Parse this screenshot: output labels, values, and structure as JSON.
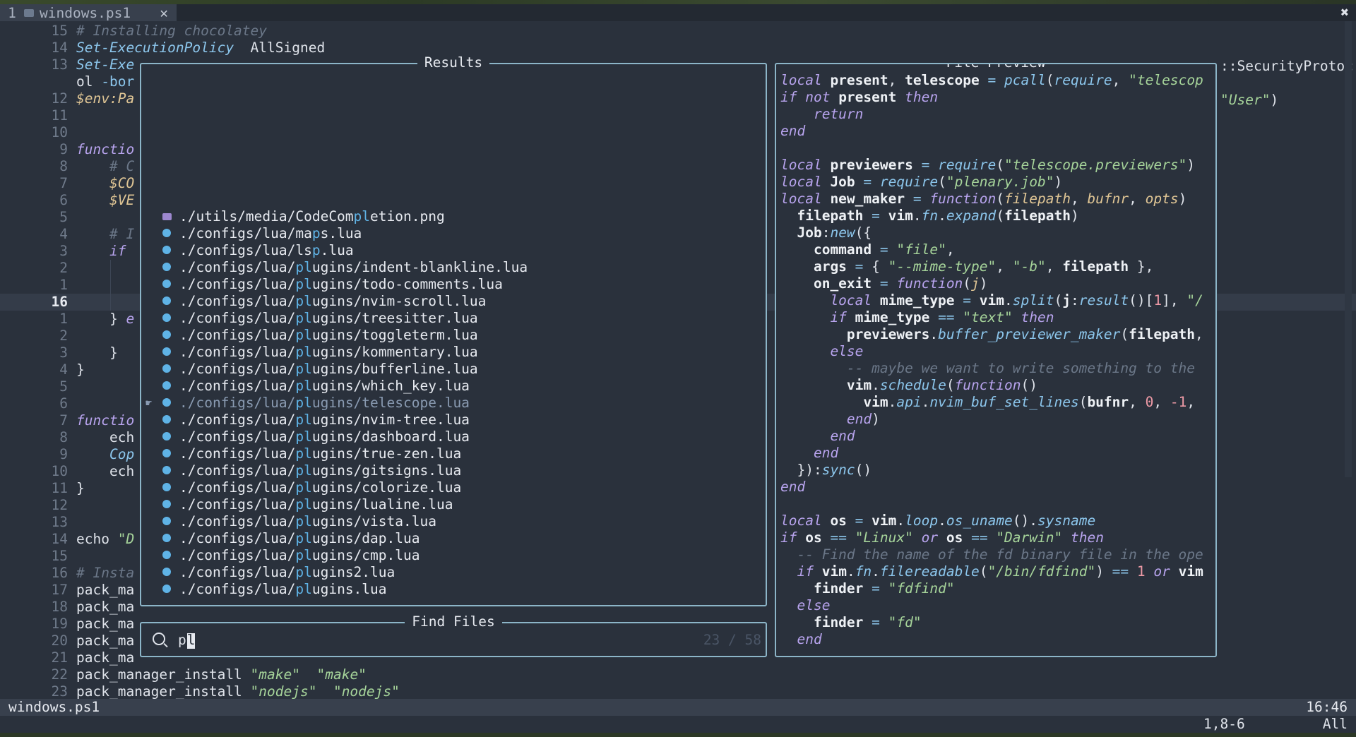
{
  "tabline": {
    "number": "1",
    "filename": "windows.ps1",
    "close": "✕",
    "window_close": "✖"
  },
  "editor": {
    "lines": [
      {
        "n": "15",
        "parts": [
          [
            "cm",
            "# Installing chocolatey"
          ]
        ]
      },
      {
        "n": "14",
        "parts": [
          [
            "fn",
            "Set-ExecutionPolicy"
          ],
          [
            "",
            "  AllSigned"
          ]
        ]
      },
      {
        "n": "13",
        "parts": [
          [
            "fn",
            "Set-Exe"
          ]
        ]
      },
      {
        "n": "",
        "parts": [
          [
            "",
            "ol "
          ],
          [
            "op",
            "-bor"
          ]
        ]
      },
      {
        "n": "12",
        "parts": [
          [
            "var",
            "$env:Pa"
          ]
        ]
      },
      {
        "n": "11",
        "parts": []
      },
      {
        "n": "10",
        "parts": []
      },
      {
        "n": "9",
        "parts": [
          [
            "kw",
            "functio"
          ]
        ]
      },
      {
        "n": "8",
        "parts": [
          [
            "",
            "    "
          ],
          [
            "cm",
            "# C"
          ]
        ]
      },
      {
        "n": "7",
        "parts": [
          [
            "",
            "    "
          ],
          [
            "var",
            "$CO"
          ]
        ]
      },
      {
        "n": "6",
        "parts": [
          [
            "",
            "    "
          ],
          [
            "var",
            "$VE"
          ]
        ]
      },
      {
        "n": "5",
        "parts": []
      },
      {
        "n": "4",
        "parts": [
          [
            "",
            "    "
          ],
          [
            "cm",
            "# I"
          ]
        ]
      },
      {
        "n": "3",
        "parts": [
          [
            "",
            "    "
          ],
          [
            "kw",
            "if"
          ]
        ]
      },
      {
        "n": "2",
        "parts": []
      },
      {
        "n": "1",
        "parts": []
      },
      {
        "n": "16",
        "parts": [],
        "current": true
      },
      {
        "n": "1",
        "parts": [
          [
            "",
            "    } "
          ],
          [
            "kw",
            "e"
          ]
        ]
      },
      {
        "n": "2",
        "parts": []
      },
      {
        "n": "3",
        "parts": [
          [
            "",
            "    }"
          ]
        ]
      },
      {
        "n": "4",
        "parts": [
          [
            "",
            "}"
          ]
        ]
      },
      {
        "n": "5",
        "parts": []
      },
      {
        "n": "6",
        "parts": []
      },
      {
        "n": "7",
        "parts": [
          [
            "kw",
            "functio"
          ]
        ]
      },
      {
        "n": "8",
        "parts": [
          [
            "",
            "    ech"
          ]
        ]
      },
      {
        "n": "9",
        "parts": [
          [
            "",
            "    "
          ],
          [
            "fn",
            "Cop"
          ]
        ]
      },
      {
        "n": "10",
        "parts": [
          [
            "",
            "    ech"
          ]
        ]
      },
      {
        "n": "11",
        "parts": [
          [
            "",
            "}"
          ]
        ]
      },
      {
        "n": "12",
        "parts": []
      },
      {
        "n": "13",
        "parts": []
      },
      {
        "n": "14",
        "parts": [
          [
            "",
            "echo "
          ],
          [
            "str",
            "\"D"
          ]
        ]
      },
      {
        "n": "15",
        "parts": []
      },
      {
        "n": "16",
        "parts": [
          [
            "cm",
            "# Insta"
          ]
        ]
      },
      {
        "n": "17",
        "parts": [
          [
            "",
            "pack_ma"
          ]
        ]
      },
      {
        "n": "18",
        "parts": [
          [
            "",
            "pack_ma"
          ]
        ]
      },
      {
        "n": "19",
        "parts": [
          [
            "",
            "pack_ma"
          ]
        ]
      },
      {
        "n": "20",
        "parts": [
          [
            "",
            "pack_ma"
          ]
        ]
      },
      {
        "n": "21",
        "parts": [
          [
            "",
            "pack_ma"
          ]
        ]
      },
      {
        "n": "22",
        "parts": [
          [
            "",
            "pack_manager_install "
          ],
          [
            "str",
            "\"make\""
          ],
          [
            "",
            "  "
          ],
          [
            "str",
            "\"make\""
          ]
        ]
      },
      {
        "n": "23",
        "parts": [
          [
            "",
            "pack_manager_install "
          ],
          [
            "str",
            "\"nodejs\""
          ],
          [
            "",
            "  "
          ],
          [
            "str",
            "\"nodejs\""
          ]
        ]
      }
    ],
    "right_snippets": [
      {
        "row": 2,
        "parts": [
          [
            "",
            "::SecurityProtoc"
          ]
        ]
      },
      {
        "row": 4,
        "parts": [
          [
            "str",
            "\"User\""
          ],
          [
            "",
            ")"
          ]
        ]
      }
    ]
  },
  "results": {
    "title": "Results",
    "items": [
      {
        "icon": "image-file-icon",
        "pre": "./utils/media/CodeCom",
        "hl": "pl",
        "post": "etion.png"
      },
      {
        "icon": "lua-file-icon",
        "pre": "./configs/lua/ma",
        "hl": "p",
        "post": "s.lua"
      },
      {
        "icon": "lua-file-icon",
        "pre": "./configs/lua/ls",
        "hl": "p",
        "post": ".lua"
      },
      {
        "icon": "lua-file-icon",
        "pre": "./configs/lua/",
        "hl": "pl",
        "post": "ugins/indent-blankline.lua"
      },
      {
        "icon": "lua-file-icon",
        "pre": "./configs/lua/",
        "hl": "pl",
        "post": "ugins/todo-comments.lua"
      },
      {
        "icon": "lua-file-icon",
        "pre": "./configs/lua/",
        "hl": "pl",
        "post": "ugins/nvim-scroll.lua"
      },
      {
        "icon": "lua-file-icon",
        "pre": "./configs/lua/",
        "hl": "pl",
        "post": "ugins/treesitter.lua"
      },
      {
        "icon": "lua-file-icon",
        "pre": "./configs/lua/",
        "hl": "pl",
        "post": "ugins/toggleterm.lua"
      },
      {
        "icon": "lua-file-icon",
        "pre": "./configs/lua/",
        "hl": "pl",
        "post": "ugins/kommentary.lua"
      },
      {
        "icon": "lua-file-icon",
        "pre": "./configs/lua/",
        "hl": "pl",
        "post": "ugins/bufferline.lua"
      },
      {
        "icon": "lua-file-icon",
        "pre": "./configs/lua/",
        "hl": "pl",
        "post": "ugins/which_key.lua"
      },
      {
        "icon": "lua-file-icon",
        "pre": "./configs/lua/",
        "hl": "pl",
        "post": "ugins/telescope.lua",
        "selected": true
      },
      {
        "icon": "lua-file-icon",
        "pre": "./configs/lua/",
        "hl": "pl",
        "post": "ugins/nvim-tree.lua"
      },
      {
        "icon": "lua-file-icon",
        "pre": "./configs/lua/",
        "hl": "pl",
        "post": "ugins/dashboard.lua"
      },
      {
        "icon": "lua-file-icon",
        "pre": "./configs/lua/",
        "hl": "pl",
        "post": "ugins/true-zen.lua"
      },
      {
        "icon": "lua-file-icon",
        "pre": "./configs/lua/",
        "hl": "pl",
        "post": "ugins/gitsigns.lua"
      },
      {
        "icon": "lua-file-icon",
        "pre": "./configs/lua/",
        "hl": "pl",
        "post": "ugins/colorize.lua"
      },
      {
        "icon": "lua-file-icon",
        "pre": "./configs/lua/",
        "hl": "pl",
        "post": "ugins/lualine.lua"
      },
      {
        "icon": "lua-file-icon",
        "pre": "./configs/lua/",
        "hl": "pl",
        "post": "ugins/vista.lua"
      },
      {
        "icon": "lua-file-icon",
        "pre": "./configs/lua/",
        "hl": "pl",
        "post": "ugins/dap.lua"
      },
      {
        "icon": "lua-file-icon",
        "pre": "./configs/lua/",
        "hl": "pl",
        "post": "ugins/cmp.lua"
      },
      {
        "icon": "lua-file-icon",
        "pre": "./configs/lua/",
        "hl": "pl",
        "post": "ugins2.lua"
      },
      {
        "icon": "lua-file-icon",
        "pre": "./configs/lua/",
        "hl": "pl",
        "post": "ugins.lua"
      }
    ]
  },
  "prompt": {
    "title": "Find Files",
    "query": "p",
    "query_under_cursor": "l",
    "count": "23 / 58"
  },
  "preview": {
    "title": "File Preview",
    "lines": [
      [
        [
          "kw",
          "local"
        ],
        [
          "bold",
          " present"
        ],
        [
          "",
          ", "
        ],
        [
          "bold",
          "telescope"
        ],
        [
          "op",
          " = "
        ],
        [
          "fn",
          "pcall"
        ],
        [
          "",
          "("
        ],
        [
          "fn",
          "require"
        ],
        [
          "",
          ", "
        ],
        [
          "str",
          "\"telescop"
        ]
      ],
      [
        [
          "kw",
          "if not"
        ],
        [
          "bold",
          " present"
        ],
        [
          "kw",
          " then"
        ]
      ],
      [
        [
          "kw",
          "    return"
        ]
      ],
      [
        [
          "kw",
          "end"
        ]
      ],
      [],
      [
        [
          "kw",
          "local"
        ],
        [
          "bold",
          " previewers"
        ],
        [
          "op",
          " = "
        ],
        [
          "fn",
          "require"
        ],
        [
          "",
          "("
        ],
        [
          "str",
          "\"telescope.previewers\""
        ],
        [
          "",
          ")"
        ]
      ],
      [
        [
          "kw",
          "local"
        ],
        [
          "bold",
          " Job"
        ],
        [
          "op",
          " = "
        ],
        [
          "fn",
          "require"
        ],
        [
          "",
          "("
        ],
        [
          "str",
          "\"plenary.job\""
        ],
        [
          "",
          ")"
        ]
      ],
      [
        [
          "kw",
          "local"
        ],
        [
          "bold",
          " new_maker"
        ],
        [
          "op",
          " = "
        ],
        [
          "kw",
          "function"
        ],
        [
          "",
          "("
        ],
        [
          "var",
          "filepath"
        ],
        [
          "",
          ", "
        ],
        [
          "var",
          "bufnr"
        ],
        [
          "",
          ", "
        ],
        [
          "var",
          "opts"
        ],
        [
          "",
          ")"
        ]
      ],
      [
        [
          "bold",
          "  filepath"
        ],
        [
          "op",
          " = "
        ],
        [
          "bold",
          "vim"
        ],
        [
          "",
          "."
        ],
        [
          "fn",
          "fn"
        ],
        [
          "",
          "."
        ],
        [
          "fn",
          "expand"
        ],
        [
          "",
          "("
        ],
        [
          "bold",
          "filepath"
        ],
        [
          "",
          ")"
        ]
      ],
      [
        [
          "bold",
          "  Job"
        ],
        [
          "",
          ":"
        ],
        [
          "fn",
          "new"
        ],
        [
          "",
          "({"
        ]
      ],
      [
        [
          "bold",
          "    command"
        ],
        [
          "op",
          " = "
        ],
        [
          "str",
          "\"file\""
        ],
        [
          "",
          ","
        ]
      ],
      [
        [
          "bold",
          "    args"
        ],
        [
          "op",
          " = "
        ],
        [
          "",
          "{ "
        ],
        [
          "str",
          "\"--mime-type\""
        ],
        [
          "",
          ", "
        ],
        [
          "str",
          "\"-b\""
        ],
        [
          "",
          ", "
        ],
        [
          "bold",
          "filepath"
        ],
        [
          "",
          " },"
        ]
      ],
      [
        [
          "bold",
          "    on_exit"
        ],
        [
          "op",
          " = "
        ],
        [
          "kw",
          "function"
        ],
        [
          "",
          "("
        ],
        [
          "var",
          "j"
        ],
        [
          "",
          ")"
        ]
      ],
      [
        [
          "kw",
          "      local"
        ],
        [
          "bold",
          " mime_type"
        ],
        [
          "op",
          " = "
        ],
        [
          "bold",
          "vim"
        ],
        [
          "",
          "."
        ],
        [
          "fn",
          "split"
        ],
        [
          "",
          "("
        ],
        [
          "bold",
          "j"
        ],
        [
          "",
          ":"
        ],
        [
          "fn",
          "result"
        ],
        [
          "",
          "()["
        ],
        [
          "num",
          "1"
        ],
        [
          "",
          "], "
        ],
        [
          "str",
          "\"/"
        ]
      ],
      [
        [
          "kw",
          "      if"
        ],
        [
          "bold",
          " mime_type"
        ],
        [
          "op",
          " == "
        ],
        [
          "str",
          "\"text\""
        ],
        [
          "kw",
          " then"
        ]
      ],
      [
        [
          "bold",
          "        previewers"
        ],
        [
          "",
          "."
        ],
        [
          "fn",
          "buffer_previewer_maker"
        ],
        [
          "",
          "("
        ],
        [
          "bold",
          "filepath"
        ],
        [
          "",
          ","
        ]
      ],
      [
        [
          "kw",
          "      else"
        ]
      ],
      [
        [
          "cm",
          "        -- maybe we want to write something to the"
        ]
      ],
      [
        [
          "bold",
          "        vim"
        ],
        [
          "",
          "."
        ],
        [
          "fn",
          "schedule"
        ],
        [
          "",
          "("
        ],
        [
          "kw",
          "function"
        ],
        [
          "",
          "()"
        ]
      ],
      [
        [
          "bold",
          "          vim"
        ],
        [
          "",
          "."
        ],
        [
          "fn",
          "api"
        ],
        [
          "",
          "."
        ],
        [
          "fn",
          "nvim_buf_set_lines"
        ],
        [
          "",
          "("
        ],
        [
          "bold",
          "bufnr"
        ],
        [
          "",
          ", "
        ],
        [
          "num",
          "0"
        ],
        [
          "",
          ", "
        ],
        [
          "num",
          "-1"
        ],
        [
          "",
          ","
        ]
      ],
      [
        [
          "kw",
          "        end"
        ],
        [
          "",
          ")"
        ]
      ],
      [
        [
          "kw",
          "      end"
        ]
      ],
      [
        [
          "kw",
          "    end"
        ]
      ],
      [
        [
          "",
          "  }):"
        ],
        [
          "fn",
          "sync"
        ],
        [
          "",
          "()"
        ]
      ],
      [
        [
          "kw",
          "end"
        ]
      ],
      [],
      [
        [
          "kw",
          "local"
        ],
        [
          "bold",
          " os"
        ],
        [
          "op",
          " = "
        ],
        [
          "bold",
          "vim"
        ],
        [
          "",
          "."
        ],
        [
          "fn",
          "loop"
        ],
        [
          "",
          "."
        ],
        [
          "fn",
          "os_uname"
        ],
        [
          "",
          "()."
        ],
        [
          "fn",
          "sysname"
        ]
      ],
      [
        [
          "kw",
          "if"
        ],
        [
          "bold",
          " os"
        ],
        [
          "op",
          " == "
        ],
        [
          "str",
          "\"Linux\""
        ],
        [
          "kw",
          " or"
        ],
        [
          "bold",
          " os"
        ],
        [
          "op",
          " == "
        ],
        [
          "str",
          "\"Darwin\""
        ],
        [
          "kw",
          " then"
        ]
      ],
      [
        [
          "cm",
          "  -- Find the name of the fd binary file in the ope"
        ]
      ],
      [
        [
          "kw",
          "  if"
        ],
        [
          "bold",
          " vim"
        ],
        [
          "",
          "."
        ],
        [
          "fn",
          "fn"
        ],
        [
          "",
          "."
        ],
        [
          "fn",
          "filereadable"
        ],
        [
          "",
          "("
        ],
        [
          "str",
          "\"/bin/fdfind\""
        ],
        [
          "",
          ")"
        ],
        [
          "op",
          " == "
        ],
        [
          "num",
          "1"
        ],
        [
          "kw",
          " or"
        ],
        [
          "bold",
          " vim"
        ]
      ],
      [
        [
          "bold",
          "    finder"
        ],
        [
          "op",
          " = "
        ],
        [
          "str",
          "\"fdfind\""
        ]
      ],
      [
        [
          "kw",
          "  else"
        ]
      ],
      [
        [
          "bold",
          "    finder"
        ],
        [
          "op",
          " = "
        ],
        [
          "str",
          "\"fd\""
        ]
      ],
      [
        [
          "kw",
          "  end"
        ]
      ]
    ]
  },
  "statusline": {
    "file": "windows.ps1",
    "time": "16:46"
  },
  "cmdline": {
    "position": "1,8-6",
    "scroll": "All"
  }
}
